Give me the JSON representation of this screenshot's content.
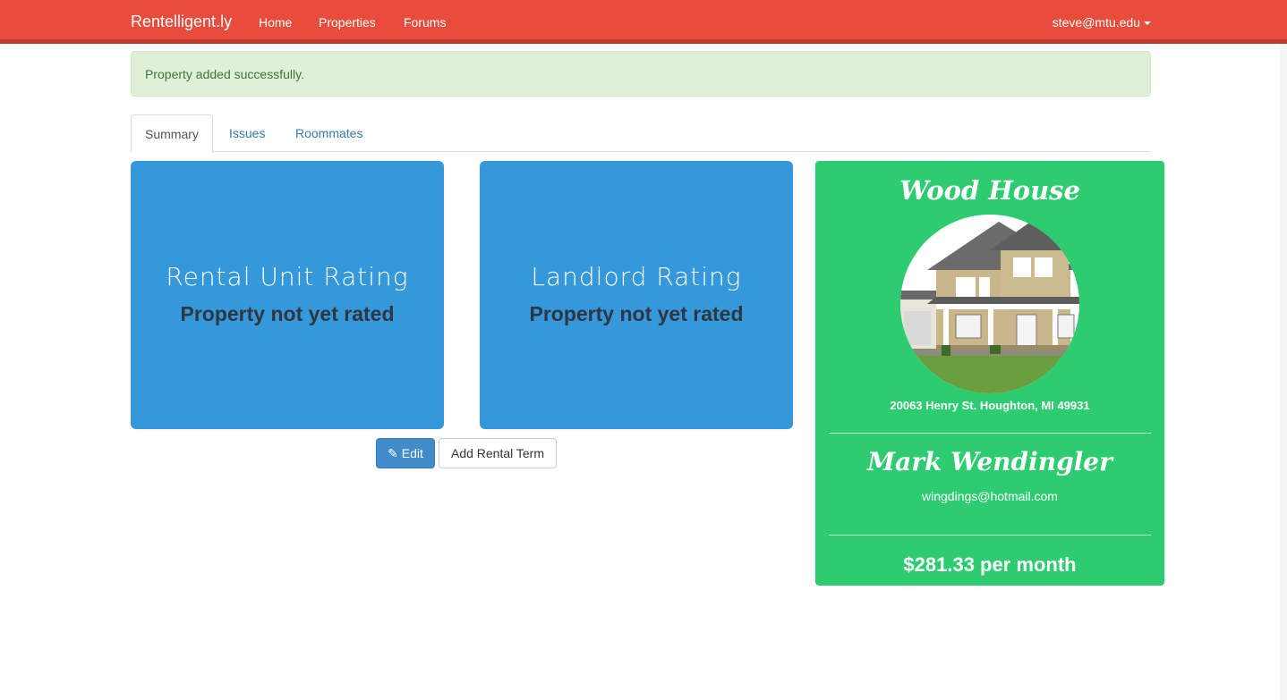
{
  "navbar": {
    "brand": "Rentelligent.ly",
    "links": [
      "Home",
      "Properties",
      "Forums"
    ],
    "user": "steve@mtu.edu",
    "color": "#e74c3c"
  },
  "alert": {
    "message": "Property added successfully."
  },
  "tabs": [
    "Summary",
    "Issues",
    "Roommates"
  ],
  "ratings": [
    {
      "title": "Rental Unit Rating",
      "value": "Property not yet rated"
    },
    {
      "title": "Landlord Rating",
      "value": "Property not yet rated"
    }
  ],
  "actions": {
    "edit": "Edit",
    "add_term": "Add Rental Term"
  },
  "property": {
    "name": "Wood House",
    "address": "20063 Henry St. Houghton, MI 49931",
    "landlord": "Mark Wendingler",
    "landlord_email": "wingdings@hotmail.com",
    "rent": "$281.33 per month"
  },
  "colors": {
    "rating_card": "#3498db",
    "side_card": "#2ecc71",
    "primary": "#428bca"
  }
}
